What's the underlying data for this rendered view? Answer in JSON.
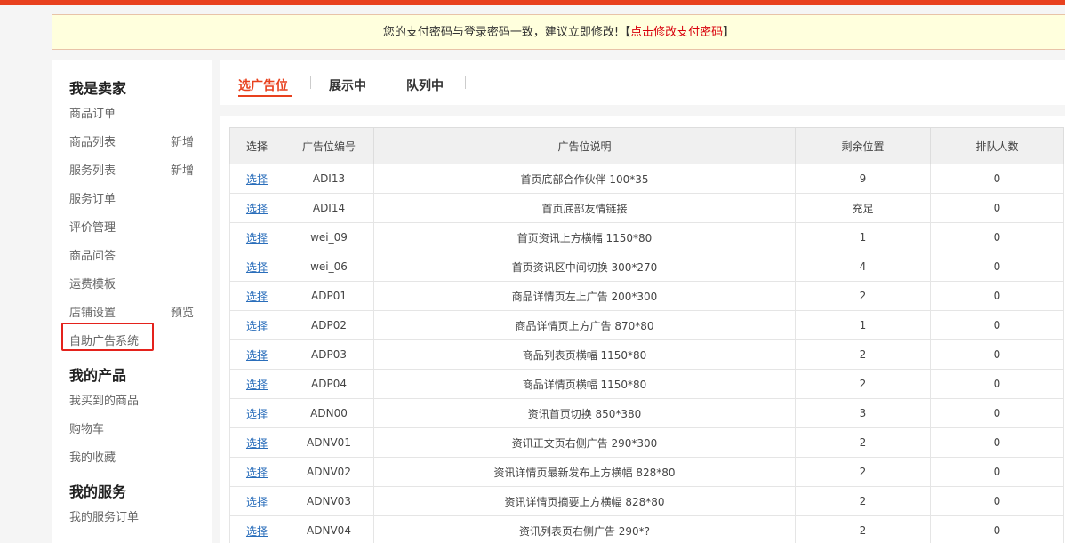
{
  "notice": {
    "text": "您的支付密码与登录密码一致，建议立即修改!",
    "bracket_open": "【",
    "link_text": "点击修改支付密码",
    "bracket_close": "】"
  },
  "sidebar": {
    "sections": [
      {
        "title": "我是卖家"
      },
      {
        "title": "我的产品"
      },
      {
        "title": "我的服务"
      }
    ],
    "seller_items": [
      {
        "label": "商品订单",
        "extra": ""
      },
      {
        "label": "商品列表",
        "extra": "新增"
      },
      {
        "label": "服务列表",
        "extra": "新增"
      },
      {
        "label": "服务订单",
        "extra": ""
      },
      {
        "label": "评价管理",
        "extra": ""
      },
      {
        "label": "商品问答",
        "extra": ""
      },
      {
        "label": "运费模板",
        "extra": ""
      },
      {
        "label": "店铺设置",
        "extra": "预览"
      },
      {
        "label": "自助广告系统",
        "extra": ""
      }
    ],
    "product_items": [
      {
        "label": "我买到的商品"
      },
      {
        "label": "购物车"
      },
      {
        "label": "我的收藏"
      }
    ],
    "service_items": [
      {
        "label": "我的服务订单"
      }
    ]
  },
  "tabs": [
    {
      "label": "选广告位",
      "active": true
    },
    {
      "label": "展示中",
      "active": false
    },
    {
      "label": "队列中",
      "active": false
    }
  ],
  "table": {
    "headers": [
      "选择",
      "广告位编号",
      "广告位说明",
      "剩余位置",
      "排队人数"
    ],
    "select_label": "选择",
    "rows": [
      {
        "code": "ADI13",
        "desc": "首页底部合作伙伴 100*35",
        "remaining": "9",
        "queue": "0"
      },
      {
        "code": "ADI14",
        "desc": "首页底部友情链接",
        "remaining": "充足",
        "queue": "0"
      },
      {
        "code": "wei_09",
        "desc": "首页资讯上方横幅 1150*80",
        "remaining": "1",
        "queue": "0"
      },
      {
        "code": "wei_06",
        "desc": "首页资讯区中间切换 300*270",
        "remaining": "4",
        "queue": "0"
      },
      {
        "code": "ADP01",
        "desc": "商品详情页左上广告 200*300",
        "remaining": "2",
        "queue": "0"
      },
      {
        "code": "ADP02",
        "desc": "商品详情页上方广告 870*80",
        "remaining": "1",
        "queue": "0"
      },
      {
        "code": "ADP03",
        "desc": "商品列表页横幅 1150*80",
        "remaining": "2",
        "queue": "0"
      },
      {
        "code": "ADP04",
        "desc": "商品详情页横幅 1150*80",
        "remaining": "2",
        "queue": "0"
      },
      {
        "code": "ADN00",
        "desc": "资讯首页切换 850*380",
        "remaining": "3",
        "queue": "0"
      },
      {
        "code": "ADNV01",
        "desc": "资讯正文页右侧广告 290*300",
        "remaining": "2",
        "queue": "0"
      },
      {
        "code": "ADNV02",
        "desc": "资讯详情页最新发布上方横幅 828*80",
        "remaining": "2",
        "queue": "0"
      },
      {
        "code": "ADNV03",
        "desc": "资讯详情页摘要上方横幅 828*80",
        "remaining": "2",
        "queue": "0"
      },
      {
        "code": "ADNV04",
        "desc": "资讯列表页右侧广告 290*?",
        "remaining": "2",
        "queue": "0"
      }
    ]
  },
  "colors": {
    "accent": "#e8411e",
    "notice_bg": "#ffffdd",
    "highlight_box": "#e4221c",
    "link": "#2a6ebb"
  }
}
